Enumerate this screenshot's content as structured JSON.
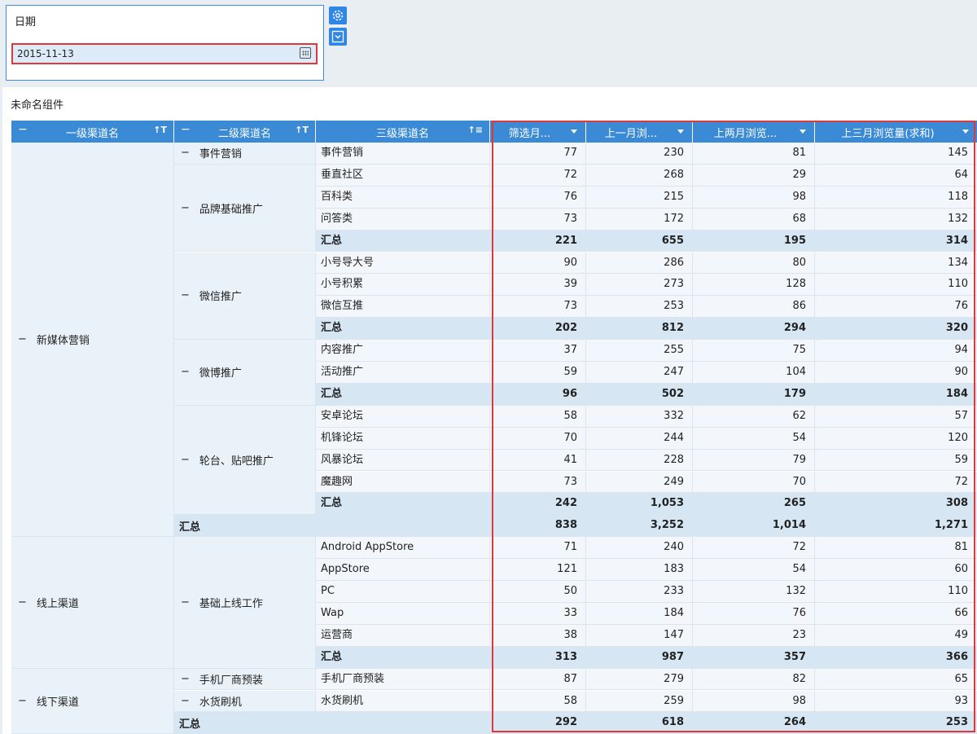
{
  "filter": {
    "title": "日期",
    "date_value": "2015-11-13",
    "settings_icon": "gear-icon",
    "collapse_icon": "chevron-down-icon"
  },
  "component": {
    "title": "未命名组件"
  },
  "table": {
    "headers": {
      "col1": "一级渠道名",
      "col2": "二级渠道名",
      "col3": "三级渠道名",
      "col4": "筛选月...",
      "col5": "上一月浏...",
      "col6": "上两月浏览...",
      "col7": "上三月浏览量(求和)"
    },
    "minus": "−",
    "rows": [
      {
        "l1": "新媒体营销",
        "l2": "事件营销",
        "l3": "事件营销",
        "v": [
          "77",
          "230",
          "81",
          "145"
        ],
        "total": false
      },
      {
        "l1": "",
        "l2": "品牌基础推广",
        "l3": "垂直社区",
        "v": [
          "72",
          "268",
          "29",
          "64"
        ],
        "total": false
      },
      {
        "l1": "",
        "l2": "",
        "l3": "百科类",
        "v": [
          "76",
          "215",
          "98",
          "118"
        ],
        "total": false
      },
      {
        "l1": "",
        "l2": "",
        "l3": "问答类",
        "v": [
          "73",
          "172",
          "68",
          "132"
        ],
        "total": false
      },
      {
        "l1": "",
        "l2": "",
        "l3": "汇总",
        "v": [
          "221",
          "655",
          "195",
          "314"
        ],
        "total": true
      },
      {
        "l1": "",
        "l2": "微信推广",
        "l3": "小号导大号",
        "v": [
          "90",
          "286",
          "80",
          "134"
        ],
        "total": false
      },
      {
        "l1": "",
        "l2": "",
        "l3": "小号积累",
        "v": [
          "39",
          "273",
          "128",
          "110"
        ],
        "total": false
      },
      {
        "l1": "",
        "l2": "",
        "l3": "微信互推",
        "v": [
          "73",
          "253",
          "86",
          "76"
        ],
        "total": false
      },
      {
        "l1": "",
        "l2": "",
        "l3": "汇总",
        "v": [
          "202",
          "812",
          "294",
          "320"
        ],
        "total": true
      },
      {
        "l1": "",
        "l2": "微博推广",
        "l3": "内容推广",
        "v": [
          "37",
          "255",
          "75",
          "94"
        ],
        "total": false
      },
      {
        "l1": "",
        "l2": "",
        "l3": "活动推广",
        "v": [
          "59",
          "247",
          "104",
          "90"
        ],
        "total": false
      },
      {
        "l1": "",
        "l2": "",
        "l3": "汇总",
        "v": [
          "96",
          "502",
          "179",
          "184"
        ],
        "total": true
      },
      {
        "l1": "",
        "l2": "轮台、贴吧推广",
        "l3": "安卓论坛",
        "v": [
          "58",
          "332",
          "62",
          "57"
        ],
        "total": false
      },
      {
        "l1": "",
        "l2": "",
        "l3": "机锋论坛",
        "v": [
          "70",
          "244",
          "54",
          "120"
        ],
        "total": false
      },
      {
        "l1": "",
        "l2": "",
        "l3": "风暴论坛",
        "v": [
          "41",
          "228",
          "79",
          "59"
        ],
        "total": false
      },
      {
        "l1": "",
        "l2": "",
        "l3": "魔趣网",
        "v": [
          "73",
          "249",
          "70",
          "72"
        ],
        "total": false
      },
      {
        "l1": "",
        "l2": "",
        "l3": "汇总",
        "v": [
          "242",
          "1,053",
          "265",
          "308"
        ],
        "total": true
      },
      {
        "l1": "",
        "l2": "汇总",
        "l3": "",
        "v": [
          "838",
          "3,252",
          "1,014",
          "1,271"
        ],
        "total": true
      },
      {
        "l1": "线上渠道",
        "l2": "基础上线工作",
        "l3": "Android AppStore",
        "v": [
          "71",
          "240",
          "72",
          "81"
        ],
        "total": false
      },
      {
        "l1": "",
        "l2": "",
        "l3": "AppStore",
        "v": [
          "121",
          "183",
          "54",
          "60"
        ],
        "total": false
      },
      {
        "l1": "",
        "l2": "",
        "l3": "PC",
        "v": [
          "50",
          "233",
          "132",
          "110"
        ],
        "total": false
      },
      {
        "l1": "",
        "l2": "",
        "l3": "Wap",
        "v": [
          "33",
          "184",
          "76",
          "66"
        ],
        "total": false
      },
      {
        "l1": "",
        "l2": "",
        "l3": "运营商",
        "v": [
          "38",
          "147",
          "23",
          "49"
        ],
        "total": false
      },
      {
        "l1": "",
        "l2": "",
        "l3": "汇总",
        "v": [
          "313",
          "987",
          "357",
          "366"
        ],
        "total": true
      },
      {
        "l1": "线下渠道",
        "l2": "手机厂商预装",
        "l3": "手机厂商预装",
        "v": [
          "87",
          "279",
          "82",
          "65"
        ],
        "total": false
      },
      {
        "l1": "",
        "l2": "水货刷机",
        "l3": "水货刷机",
        "v": [
          "58",
          "259",
          "98",
          "93"
        ],
        "total": false
      },
      {
        "l1": "",
        "l2": "汇总",
        "l3": "",
        "v": [
          "292",
          "618",
          "264",
          "253"
        ],
        "total": true
      }
    ]
  }
}
